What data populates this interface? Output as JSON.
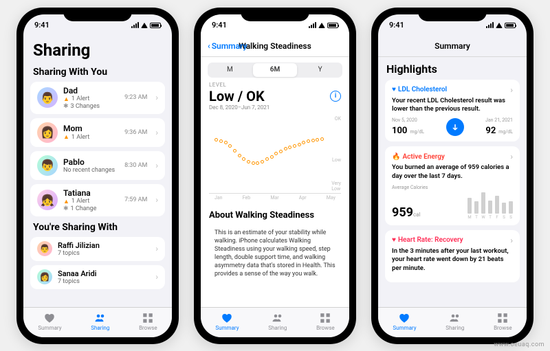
{
  "status": {
    "time": "9:41"
  },
  "tabbar": {
    "summary": "Summary",
    "sharing": "Sharing",
    "browse": "Browse"
  },
  "phone1": {
    "title": "Sharing",
    "section_with_you": "Sharing With You",
    "section_youre": "You're Sharing With",
    "contacts": [
      {
        "name": "Dad",
        "alert": "1 Alert",
        "changes": "3 Changes",
        "time": "9:23 AM"
      },
      {
        "name": "Mom",
        "alert": "1 Alert",
        "changes": "",
        "time": "9:36 AM"
      },
      {
        "name": "Pablo",
        "sub": "No recent changes",
        "time": "8:30 AM"
      },
      {
        "name": "Tatiana",
        "alert": "1 Alert",
        "changes": "1 Change",
        "time": "7:59 AM"
      }
    ],
    "sharing_with": [
      {
        "name": "Raffi Jilizian",
        "sub": "7 topics"
      },
      {
        "name": "Sanaa Aridi",
        "sub": "7 topics"
      }
    ]
  },
  "phone2": {
    "back": "Summary",
    "title": "Walking Steadiness",
    "seg": {
      "m": "M",
      "sixm": "6M",
      "y": "Y"
    },
    "level_label": "LEVEL",
    "level_value": "Low / OK",
    "date_range": "Dec 8, 2020–Jun 7, 2021",
    "ylabels": {
      "ok": "OK",
      "low": "Low",
      "vlow": "Very\nLow"
    },
    "xlabels": [
      "Jan",
      "Feb",
      "Mar",
      "Apr",
      "May"
    ],
    "about_h": "About Walking Steadiness",
    "about_txt": "This is an estimate of your stability while walking. iPhone calculates Walking Steadiness using your walking speed, step length, double support time, and walking asymmetry data that's stored in Health. This provides a sense of the way you walk."
  },
  "phone3": {
    "nav": "Summary",
    "highlights": "Highlights",
    "ldl": {
      "title": "LDL Cholesterol",
      "txt": "Your recent LDL Cholesterol result was lower than the previous result.",
      "d1": "Nov 5, 2020",
      "v1": "100",
      "u1": "mg/dL",
      "d2": "Jan 21, 2021",
      "v2": "92",
      "u2": "mg/dL"
    },
    "energy": {
      "title": "Active Energy",
      "txt": "You burned an average of 959 calories a day over the last 7 days.",
      "avg_lbl": "Average Calories",
      "avg_val": "959",
      "avg_unit": "cal",
      "days": [
        "M",
        "T",
        "W",
        "T",
        "F",
        "S",
        "S"
      ]
    },
    "hr": {
      "title": "Heart Rate: Recovery",
      "txt": "In the 3 minutes after your last workout, your heart rate went down by 21 beats per minute."
    }
  },
  "watermark": "www.oeuaq.com"
}
